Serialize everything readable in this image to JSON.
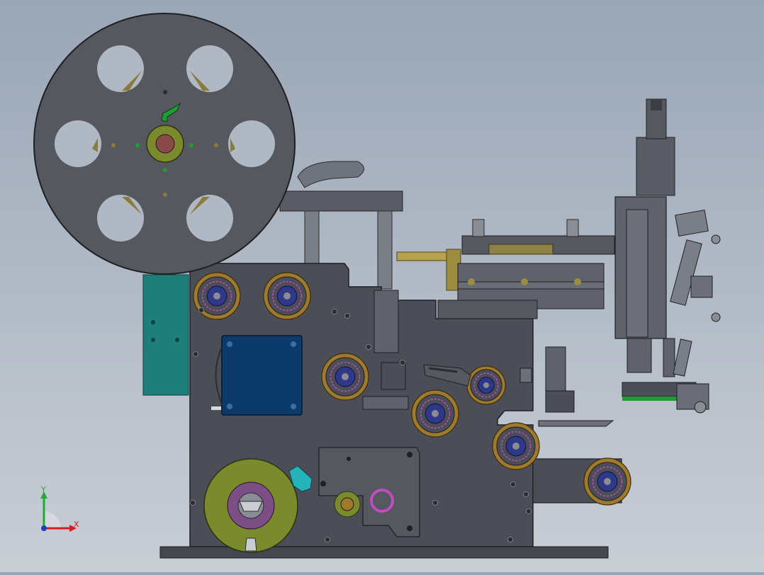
{
  "viewport": {
    "background_top": "#9aa6b6",
    "background_bottom": "#c9ced5"
  },
  "triad": {
    "x_label": "X",
    "y_label": "Y",
    "x_color": "#d21f1f",
    "y_color": "#22a83a",
    "z_color": "#1f3fbf"
  },
  "colors": {
    "frame": "#4a4d55",
    "frame_dark": "#3a3c42",
    "roller_bronze": "#a07a2c",
    "roller_core": "#30388a",
    "roller_ring": "#c04cc0",
    "motor_blue": "#0c3a6a",
    "spindle_green": "#7b8a2d",
    "plate_teal": "#1e7f7a",
    "brass_rod": "#b6a34c",
    "cyan_handle": "#25b3b9",
    "green_lever": "#1f9d34"
  }
}
